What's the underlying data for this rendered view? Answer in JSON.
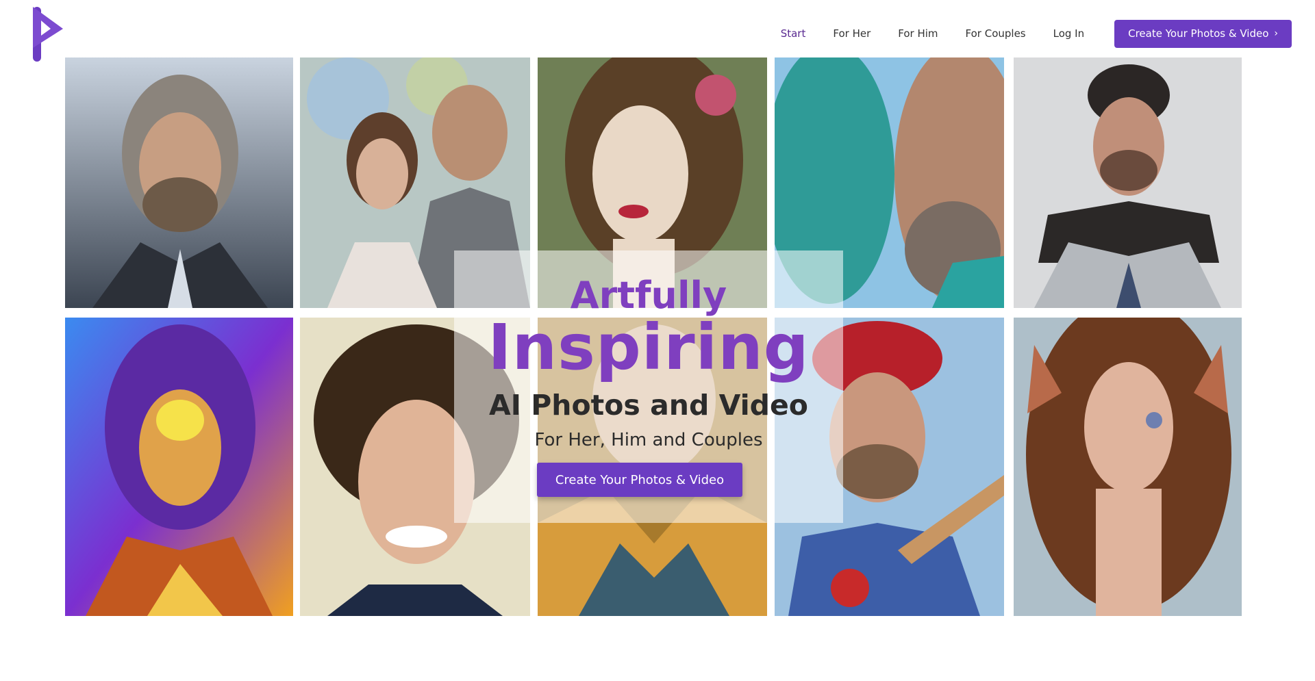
{
  "brand": {
    "accent": "#6b3cc2",
    "headline_color": "#7f3fbf"
  },
  "nav": {
    "items": [
      {
        "label": "Start",
        "active": true
      },
      {
        "label": "For Her"
      },
      {
        "label": "For Him"
      },
      {
        "label": "For Couples"
      },
      {
        "label": "Log In"
      }
    ],
    "cta_label": "Create Your Photos & Video",
    "cta_icon": "chevron-right-icon"
  },
  "hero": {
    "line1": "Artfully",
    "line2": "Inspiring",
    "line3": "AI Photos and Video",
    "line4": "For Her, Him and Couples",
    "button_label": "Create Your Photos & Video"
  },
  "gallery": {
    "tiles": [
      {
        "subject": "bearded man with long grey hair in armor"
      },
      {
        "subject": "couple portrait, woman and man in suit"
      },
      {
        "subject": "woman with flowers in long hair"
      },
      {
        "subject": "teal mosaic face facing bearded man"
      },
      {
        "subject": "dark-haired man in silver armor"
      },
      {
        "subject": "woman in neon helmet and armor"
      },
      {
        "subject": "curly-haired smiling young man"
      },
      {
        "subject": "woman portrait with golden feathers"
      },
      {
        "subject": "baseball player with red cap and bat"
      },
      {
        "subject": "elf woman with long auburn hair"
      }
    ]
  }
}
